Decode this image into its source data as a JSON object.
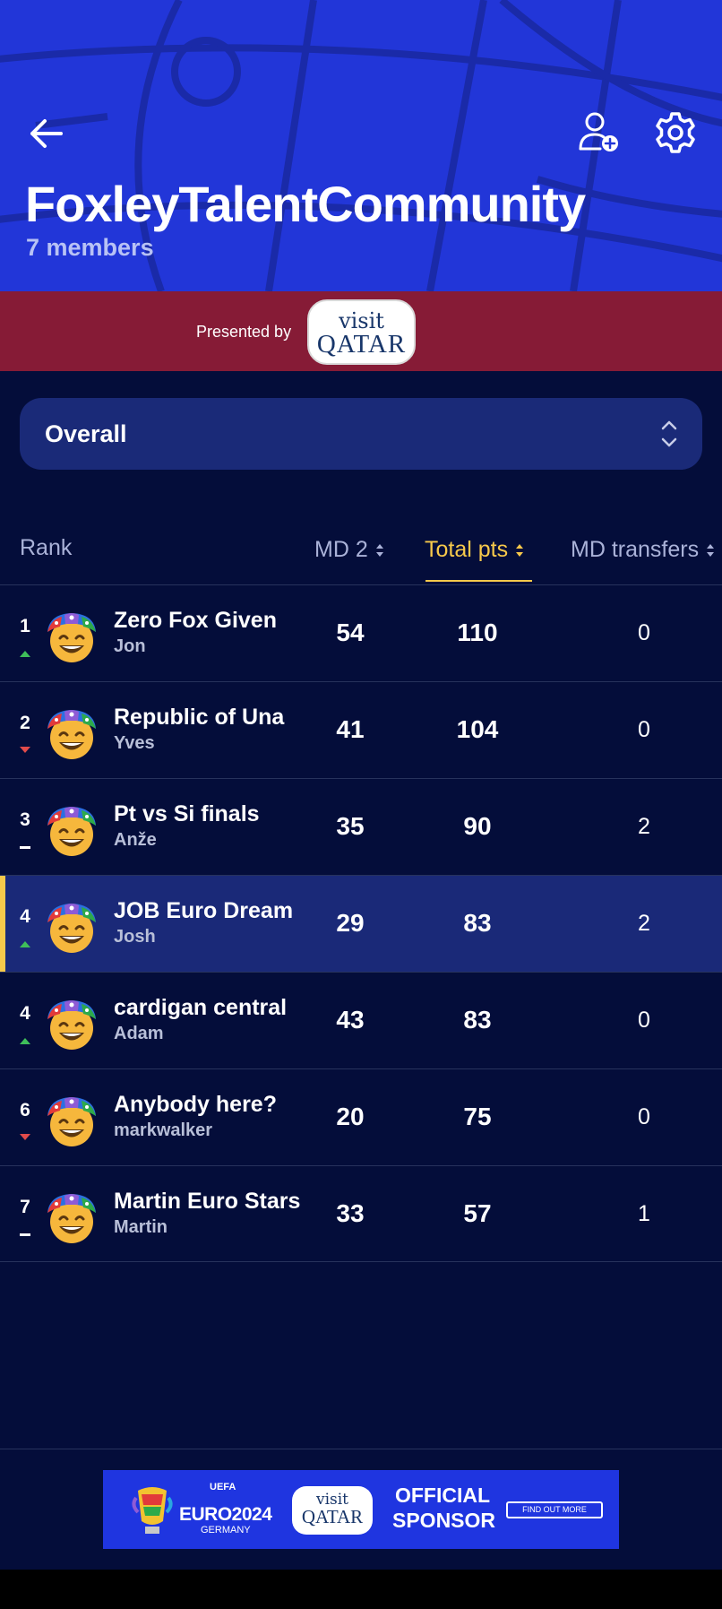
{
  "header": {
    "title": "FoxleyTalentCommunity",
    "members": "7 members",
    "bg_color": "#2236d8"
  },
  "icons": {
    "back": "arrow-left-icon",
    "add_member": "user-plus-icon",
    "settings": "gear-icon"
  },
  "sponsor": {
    "presented_by": "Presented by",
    "badge_top": "visit",
    "badge_bottom": "QATAR",
    "bg_color": "#861b36"
  },
  "filter": {
    "selected": "Overall"
  },
  "table": {
    "columns": {
      "rank": "Rank",
      "md": "MD 2",
      "total": "Total pts",
      "transfers": "MD transfers"
    },
    "accent_color": "#f7c94b",
    "rows": [
      {
        "rank": "1",
        "trend": "up",
        "team": "Zero Fox Given",
        "manager": "Jon",
        "md": "54",
        "total": "110",
        "transfers": "0",
        "highlight": false
      },
      {
        "rank": "2",
        "trend": "down",
        "team": "Republic of Una",
        "manager": "Yves",
        "md": "41",
        "total": "104",
        "transfers": "0",
        "highlight": false
      },
      {
        "rank": "3",
        "trend": "same",
        "team": "Pt vs Si finals",
        "manager": "Anže",
        "md": "35",
        "total": "90",
        "transfers": "2",
        "highlight": false
      },
      {
        "rank": "4",
        "trend": "up",
        "team": "JOB Euro Dream",
        "manager": "Josh",
        "md": "29",
        "total": "83",
        "transfers": "2",
        "highlight": true
      },
      {
        "rank": "4",
        "trend": "up",
        "team": "cardigan central",
        "manager": "Adam",
        "md": "43",
        "total": "83",
        "transfers": "0",
        "highlight": false
      },
      {
        "rank": "6",
        "trend": "down",
        "team": "Anybody here?",
        "manager": "markwalker",
        "md": "20",
        "total": "75",
        "transfers": "0",
        "highlight": false
      },
      {
        "rank": "7",
        "trend": "same",
        "team": "Martin Euro Stars",
        "manager": "Martin",
        "md": "33",
        "total": "57",
        "transfers": "1",
        "highlight": false
      }
    ]
  },
  "ad": {
    "uefa": "UEFA",
    "euro": "EURO2024",
    "germany": "GERMANY",
    "badge_top": "visit",
    "badge_bottom": "QATAR",
    "official_line1": "OFFICIAL",
    "official_line2": "SPONSOR",
    "cta": "FIND OUT MORE"
  }
}
